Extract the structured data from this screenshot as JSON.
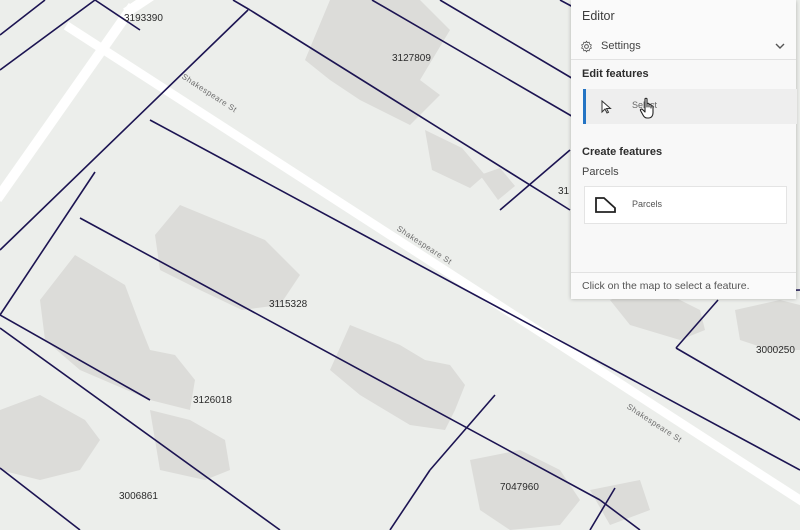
{
  "map": {
    "parcel_labels": [
      "3193390",
      "3127809",
      "3115328",
      "3126018",
      "3006861",
      "7047960",
      "3000250",
      "31"
    ],
    "street_name": "Shakespeare St",
    "colors": {
      "background": "#eceeeb",
      "parcel_line": "#1c1452",
      "road": "#ffffff",
      "building": "#dcdcd9"
    }
  },
  "editor": {
    "title": "Editor",
    "settings_label": "Settings",
    "settings_icon": "gear-icon",
    "expand_icon": "chevron-down-icon",
    "edit_features_title": "Edit features",
    "select_tool_label": "Select",
    "select_icon": "cursor-arrow-icon",
    "create_features_title": "Create features",
    "layer_name": "Parcels",
    "template_label": "Parcels",
    "template_icon": "polygon-icon",
    "footer_hint": "Click on the map to select a feature.",
    "accent_color": "#2474c4"
  }
}
